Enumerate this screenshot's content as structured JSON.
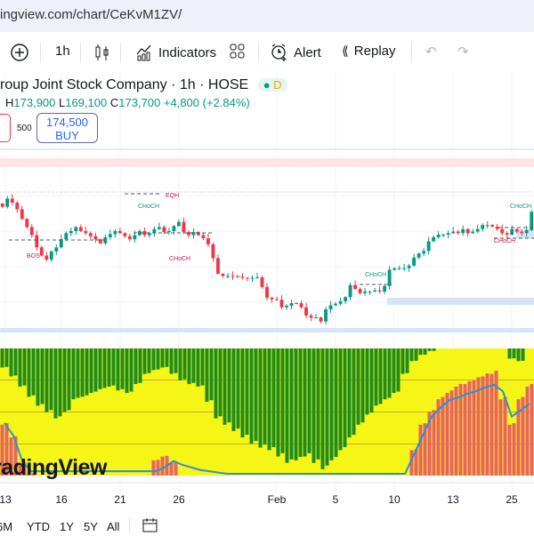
{
  "browser": {
    "url": "ingview.com/chart/CeKvM1ZV/"
  },
  "toolbar": {
    "interval": "1h",
    "indicators": "Indicators",
    "alert": "Alert",
    "replay": "Replay"
  },
  "legend": {
    "title": "roup Joint Stock Company · 1h · HOSE",
    "badge": "D",
    "h_label": "H",
    "h": "173,900",
    "l_label": "L",
    "l": "169,100",
    "c_label": "C",
    "c": "173,700",
    "change": "+4,800 (+2.84%)"
  },
  "trade": {
    "qty": "500",
    "buy_price": "174,500",
    "buy_label": "BUY"
  },
  "watermark": "radingView",
  "colors": {
    "up": "#089981",
    "down": "#f23645",
    "green_hist": "#1e8c1e",
    "yellow": "#f5f516",
    "red_hist": "#e86464",
    "line": "#2e8fd8"
  },
  "annotations": [
    {
      "text": "BOS",
      "color": "#c2185b"
    },
    {
      "text": "CHoCH",
      "color": "#089981"
    },
    {
      "text": "EQH",
      "color": "#c2185b"
    },
    {
      "text": "CHoCH",
      "color": "#c2185b"
    },
    {
      "text": "CHoCH",
      "color": "#089981"
    },
    {
      "text": "CHoCH",
      "color": "#089981"
    },
    {
      "text": "CHoCH",
      "color": "#c2185b"
    }
  ],
  "time_axis": [
    "13",
    "16",
    "21",
    "26",
    "Feb",
    "5",
    "10",
    "13",
    "25"
  ],
  "ranges": [
    "6M",
    "YTD",
    "1Y",
    "5Y",
    "All"
  ],
  "chart_data": {
    "type": "candlestick",
    "ylim": [
      148000,
      176000
    ],
    "closes": [
      172400,
      174000,
      173200,
      171900,
      170000,
      168400,
      166800,
      164400,
      162800,
      162000,
      163600,
      164400,
      166000,
      167200,
      167600,
      168400,
      167600,
      167200,
      166600,
      166000,
      165200,
      166400,
      167000,
      167600,
      167200,
      166600,
      166000,
      166800,
      167600,
      166800,
      167200,
      168000,
      168400,
      167400,
      167600,
      168600,
      169400,
      167400,
      166800,
      167400,
      166800,
      166200,
      165000,
      162300,
      159200,
      158800,
      158800,
      158700,
      158600,
      158400,
      158300,
      158400,
      158500,
      156600,
      154500,
      154200,
      154100,
      152600,
      152900,
      153400,
      153400,
      152600,
      151000,
      150600,
      150600,
      149800,
      152200,
      153000,
      153300,
      153800,
      154600,
      157000,
      156200,
      155400,
      155700,
      155700,
      155900,
      155700,
      156800,
      160000,
      160300,
      160300,
      160300,
      160800,
      162400,
      163200,
      163700,
      165600,
      166400,
      166900,
      166900,
      167200,
      167500,
      167200,
      168000,
      167200,
      167500,
      168000,
      168800,
      168800,
      168500,
      168000,
      167200,
      166900,
      168000,
      167500,
      167200,
      167800,
      171400
    ],
    "oscillator": {
      "green_depth": [
        0.15,
        0.22,
        0.3,
        0.38,
        0.45,
        0.5,
        0.55,
        0.5,
        0.4,
        0.38,
        0.35,
        0.32,
        0.3,
        0.33,
        0.35,
        0.28,
        0.2,
        0.17,
        0.15,
        0.2,
        0.25,
        0.28,
        0.3,
        0.42,
        0.55,
        0.6,
        0.65,
        0.7,
        0.75,
        0.78,
        0.8,
        0.85,
        0.9,
        0.88,
        0.85,
        0.9,
        0.95,
        0.88,
        0.8,
        0.7,
        0.6,
        0.52,
        0.45,
        0.4,
        0.35,
        0.2,
        0.1,
        0.05,
        0.02,
        0,
        0,
        0,
        0,
        0,
        0,
        0,
        0,
        0.08,
        0.1,
        0
      ],
      "red_height": [
        0.4,
        0.3,
        0.1,
        0.02,
        0,
        0,
        0,
        0,
        0,
        0,
        0,
        0,
        0,
        0,
        0,
        0,
        0,
        0.12,
        0.15,
        0.1,
        0,
        0,
        0,
        0,
        0,
        0,
        0,
        0,
        0,
        0,
        0,
        0,
        0,
        0,
        0,
        0,
        0,
        0,
        0,
        0,
        0,
        0,
        0,
        0,
        0,
        0,
        0.2,
        0.4,
        0.5,
        0.6,
        0.65,
        0.7,
        0.72,
        0.75,
        0.78,
        0.8,
        0.6,
        0.4,
        0.6,
        0.7
      ],
      "line": [
        0.4,
        0.3,
        0.1,
        0.02,
        0.02,
        0.02,
        0.02,
        0.02,
        0.02,
        0.02,
        0.02,
        0.02,
        0.02,
        0.02,
        0.02,
        0.02,
        0.02,
        0.02,
        0.05,
        0.1,
        0.07,
        0.05,
        0.03,
        0.02,
        0.01,
        0,
        0,
        0,
        0,
        0,
        0,
        0,
        0,
        0,
        0,
        0,
        0,
        0,
        0,
        0,
        0,
        0,
        0,
        0,
        0,
        0,
        0.15,
        0.3,
        0.45,
        0.52,
        0.58,
        0.6,
        0.63,
        0.65,
        0.68,
        0.7,
        0.65,
        0.45,
        0.5,
        0.55
      ]
    }
  }
}
